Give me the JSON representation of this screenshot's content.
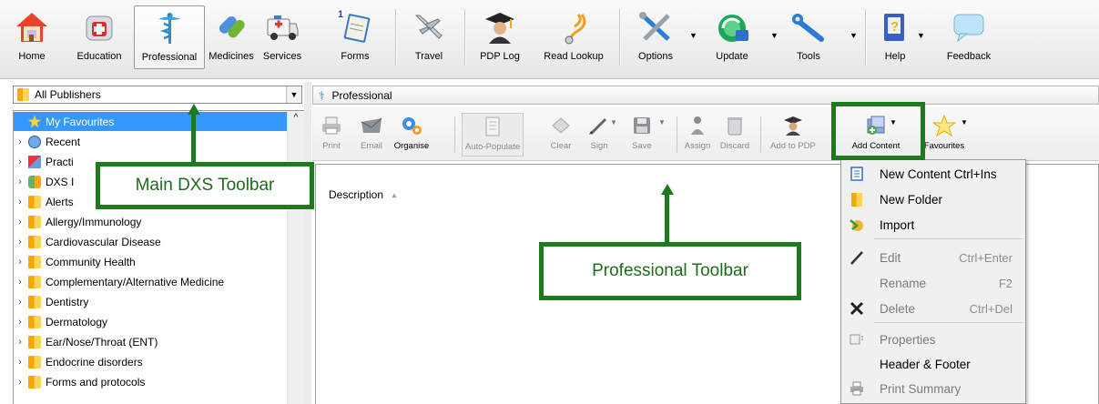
{
  "main_toolbar": {
    "buttons": [
      {
        "label": "Home",
        "icon": "home-icon"
      },
      {
        "label": "Education",
        "icon": "education-icon"
      },
      {
        "label": "Professional",
        "icon": "caduceus-icon"
      },
      {
        "label": "Medicines",
        "icon": "pills-icon"
      },
      {
        "label": "Services",
        "icon": "ambulance-icon"
      },
      {
        "label": "Forms",
        "icon": "forms-icon"
      },
      {
        "label": "Travel",
        "icon": "airplane-icon"
      },
      {
        "label": "PDP Log",
        "icon": "graduate-icon"
      },
      {
        "label": "Read Lookup",
        "icon": "stethoscope-icon"
      },
      {
        "label": "Options",
        "icon": "options-tools-icon"
      },
      {
        "label": "Update",
        "icon": "update-icon"
      },
      {
        "label": "Tools",
        "icon": "wrench-icon"
      },
      {
        "label": "Help",
        "icon": "help-book-icon"
      },
      {
        "label": "Feedback",
        "icon": "speech-bubble-icon"
      }
    ],
    "forms_badge": "1"
  },
  "publisher_combo": {
    "value": "All Publishers"
  },
  "tree": {
    "items": [
      {
        "label": "My Favourites"
      },
      {
        "label": "Recent"
      },
      {
        "label": "Practi"
      },
      {
        "label": "DXS I"
      },
      {
        "label": "Alerts"
      },
      {
        "label": "Allergy/Immunology"
      },
      {
        "label": "Cardiovascular Disease"
      },
      {
        "label": "Community Health"
      },
      {
        "label": "Complementary/Alternative Medicine"
      },
      {
        "label": "Dentistry"
      },
      {
        "label": "Dermatology"
      },
      {
        "label": "Ear/Nose/Throat (ENT)"
      },
      {
        "label": "Endocrine disorders"
      },
      {
        "label": "Forms and protocols"
      }
    ]
  },
  "professional_header": {
    "title": "Professional"
  },
  "professional_toolbar": {
    "buttons": [
      {
        "label": "Print"
      },
      {
        "label": "Email"
      },
      {
        "label": "Organise"
      },
      {
        "label": "Auto-Populate"
      },
      {
        "label": "Clear"
      },
      {
        "label": "Sign"
      },
      {
        "label": "Save"
      },
      {
        "label": "Assign"
      },
      {
        "label": "Discard"
      },
      {
        "label": "Add to PDP"
      },
      {
        "label": "Add Content"
      },
      {
        "label": "Favourites"
      }
    ]
  },
  "content": {
    "column_header": "Description"
  },
  "callouts": {
    "main": "Main DXS Toolbar",
    "professional": "Professional Toolbar"
  },
  "context_menu": {
    "items": [
      {
        "label": "New Content Ctrl+Ins",
        "shortcut": "",
        "icon": "document-icon"
      },
      {
        "label": "New Folder",
        "shortcut": "",
        "icon": "folder-icon"
      },
      {
        "label": "Import",
        "shortcut": "",
        "icon": "import-icon"
      },
      {
        "label": "Edit",
        "shortcut": "Ctrl+Enter",
        "icon": "pencil-icon"
      },
      {
        "label": "Rename",
        "shortcut": "F2",
        "icon": ""
      },
      {
        "label": "Delete",
        "shortcut": "Ctrl+Del",
        "icon": "delete-x-icon"
      },
      {
        "label": "Properties",
        "shortcut": "",
        "icon": "properties-icon"
      },
      {
        "label": "Header & Footer",
        "shortcut": "",
        "icon": ""
      },
      {
        "label": "Print Summary",
        "shortcut": "",
        "icon": "printer-icon"
      }
    ]
  }
}
